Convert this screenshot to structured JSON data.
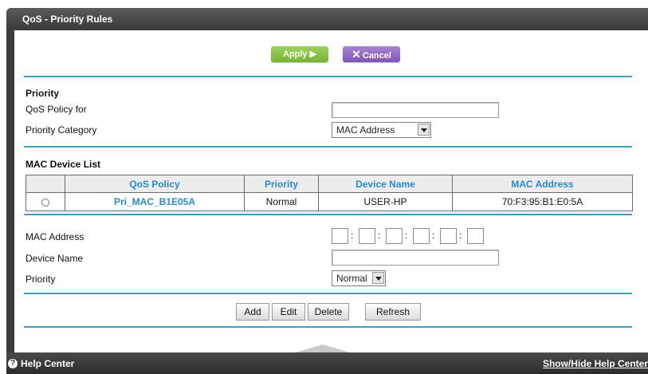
{
  "window": {
    "title": "QoS - Priority Rules"
  },
  "toolbar": {
    "apply_label": "Apply ▶",
    "cancel_label": "Cancel"
  },
  "priority": {
    "heading": "Priority",
    "policy_for_label": "QoS Policy for",
    "policy_for_value": "",
    "category_label": "Priority Category",
    "category_value": "MAC Address"
  },
  "mac_list": {
    "heading": "MAC Device List",
    "columns": [
      "",
      "QoS Policy",
      "Priority",
      "Device Name",
      "MAC Address"
    ],
    "rows": [
      {
        "policy": "Pri_MAC_B1E05A",
        "priority": "Normal",
        "device": "USER-HP",
        "mac": "70:F3:95:B1:E0:5A"
      }
    ]
  },
  "form": {
    "mac_label": "MAC Address",
    "mac_segments": [
      "",
      "",
      "",
      "",
      "",
      ""
    ],
    "device_label": "Device Name",
    "device_value": "",
    "priority_label": "Priority",
    "priority_value": "Normal"
  },
  "actions": {
    "add": "Add",
    "edit": "Edit",
    "delete": "Delete",
    "refresh": "Refresh"
  },
  "footer": {
    "help_center": "Help Center",
    "show_hide": "Show/Hide Help Center"
  },
  "colors": {
    "accent": "#3e9bc7",
    "apply": "#8cc63f",
    "cancel": "#9069c0",
    "link": "#2a8ac8"
  }
}
